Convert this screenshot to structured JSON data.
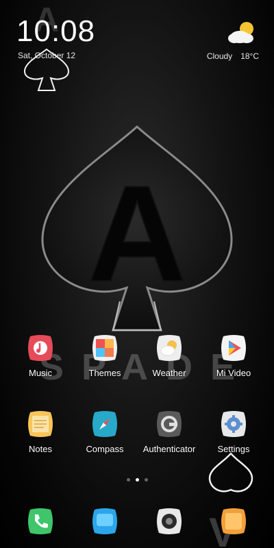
{
  "status": {
    "time": "10:08",
    "date": "Sat, October 12",
    "weather_condition": "Cloudy",
    "temperature": "18°C",
    "weather_icon": "partly-cloudy-icon"
  },
  "wallpaper": {
    "big_letter": "A",
    "small_letter": "A",
    "word": "SPADE",
    "dock_letter": "V"
  },
  "apps_row1": [
    {
      "label": "Music",
      "icon": "music-icon",
      "color": "#e54b59"
    },
    {
      "label": "Themes",
      "icon": "themes-icon",
      "color": "#f37a4d"
    },
    {
      "label": "Weather",
      "icon": "weather-icon",
      "color": "#f5c04a"
    },
    {
      "label": "Mi Video",
      "icon": "mi-video-icon",
      "color": "#ffffff"
    }
  ],
  "apps_row2": [
    {
      "label": "Notes",
      "icon": "notes-icon",
      "color": "#f7c55a"
    },
    {
      "label": "Compass",
      "icon": "compass-icon",
      "color": "#27a9c9"
    },
    {
      "label": "Authenticator",
      "icon": "authenticator-icon",
      "color": "#6b6b6b"
    },
    {
      "label": "Settings",
      "icon": "settings-icon",
      "color": "#5b8fd1"
    }
  ],
  "dock": [
    {
      "icon": "phone-icon",
      "color": "#3fc56a"
    },
    {
      "icon": "messages-icon",
      "color": "#2ca6ea"
    },
    {
      "icon": "camera-icon",
      "color": "#2a2a2a"
    },
    {
      "icon": "browser-icon",
      "color": "#f3a03a"
    }
  ],
  "pages": {
    "count": 3,
    "active": 2
  }
}
